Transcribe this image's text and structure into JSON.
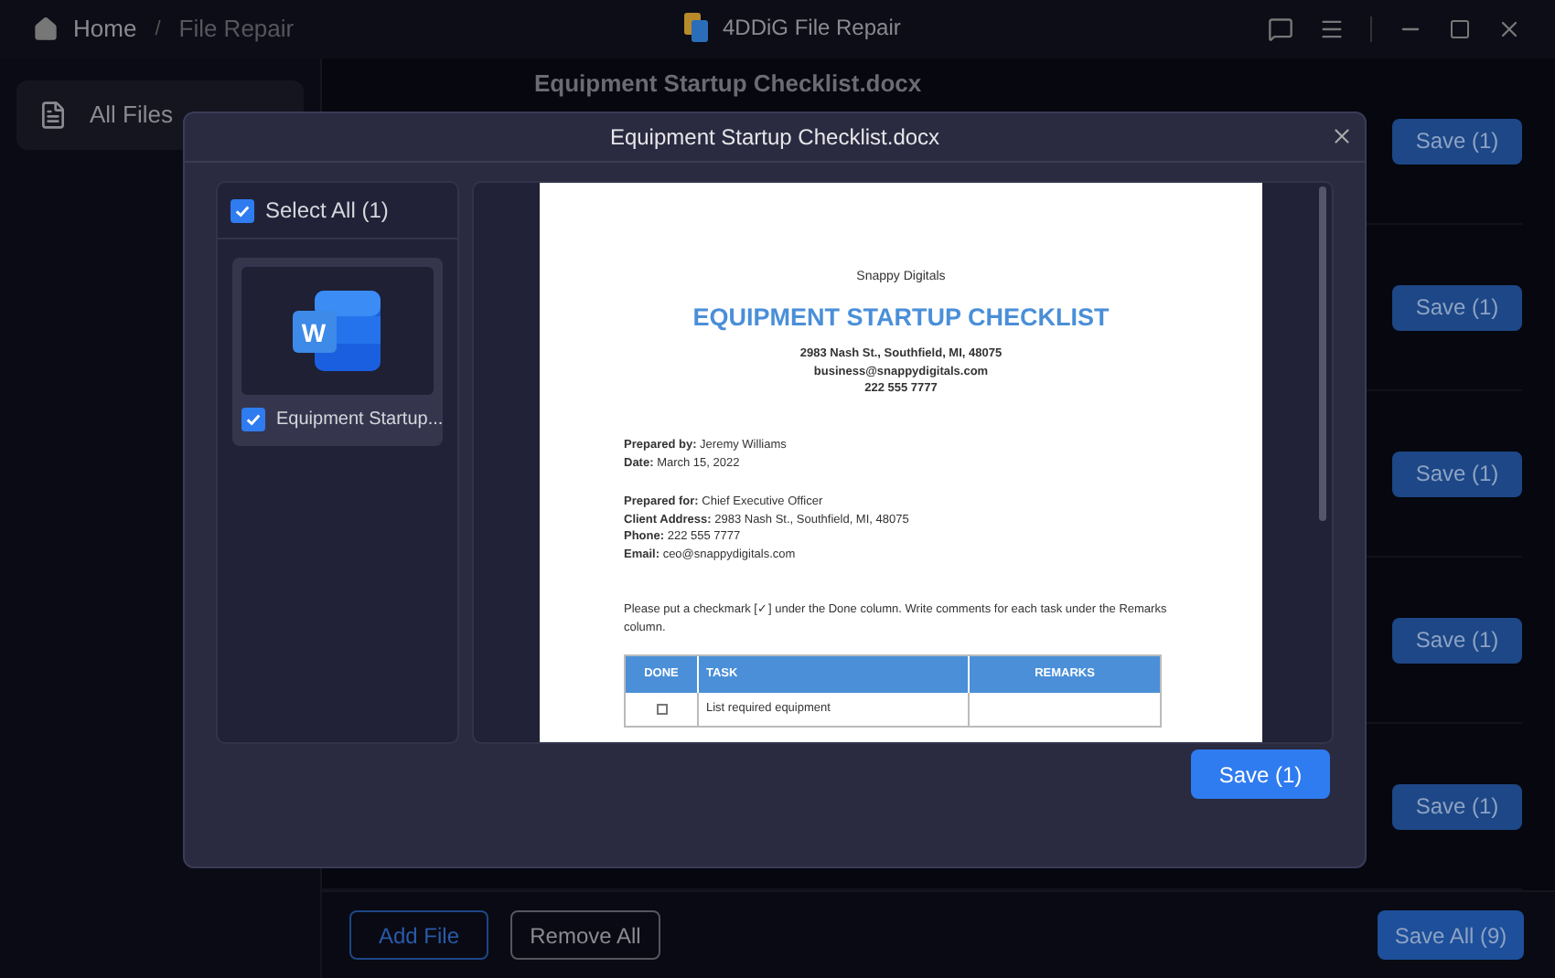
{
  "titlebar": {
    "separator": "/",
    "breadcrumb": [
      {
        "label": "Home"
      },
      {
        "label": "File Repair"
      }
    ],
    "app_title": "4DDiG File Repair"
  },
  "sidebar": {
    "items": [
      {
        "label": "All Files",
        "selected": true
      }
    ]
  },
  "files": [
    {
      "name": "Equipment Startup Checklist.docx",
      "save": "Save (1)"
    },
    {
      "save": "Save (1)"
    },
    {
      "save": "Save (1)"
    },
    {
      "save": "Save (1)"
    },
    {
      "save": "Save (1)"
    }
  ],
  "footer": {
    "add": "Add File",
    "remove": "Remove All",
    "save_all": "Save All (9)"
  },
  "dialog": {
    "title": "Equipment Startup Checklist.docx",
    "select_all": {
      "label": "Select All (1)",
      "checked": true
    },
    "files": [
      {
        "name": "Equipment Startup...",
        "icon_letter": "W",
        "checked": true,
        "selected": true
      }
    ],
    "document": {
      "company": "Snappy Digitals",
      "heading": "EQUIPMENT STARTUP CHECKLIST",
      "contact": [
        "2983 Nash St., Southfield, MI, 48075",
        "business@snappydigitals.com",
        "222 555 7777"
      ],
      "blocks": [
        [
          "**Prepared by:** Jeremy Williams",
          "**Date:** March 15, 2022"
        ],
        [
          "**Prepared for:** Chief Executive Officer",
          "**Client Address:** 2983 Nash St., Southfield, MI, 48075",
          "**Phone:** 222 555 7777",
          "**Email:** ceo@snappydigitals.com"
        ]
      ],
      "note": "Please put a checkmark [✓] under the Done column. Write comments for each task under the Remarks column.",
      "table": {
        "columns": [
          "DONE",
          "TASK",
          "REMARKS"
        ],
        "rows": [
          {
            "done": false,
            "task": "List required equipment"
          }
        ]
      }
    },
    "save": "Save (1)"
  }
}
